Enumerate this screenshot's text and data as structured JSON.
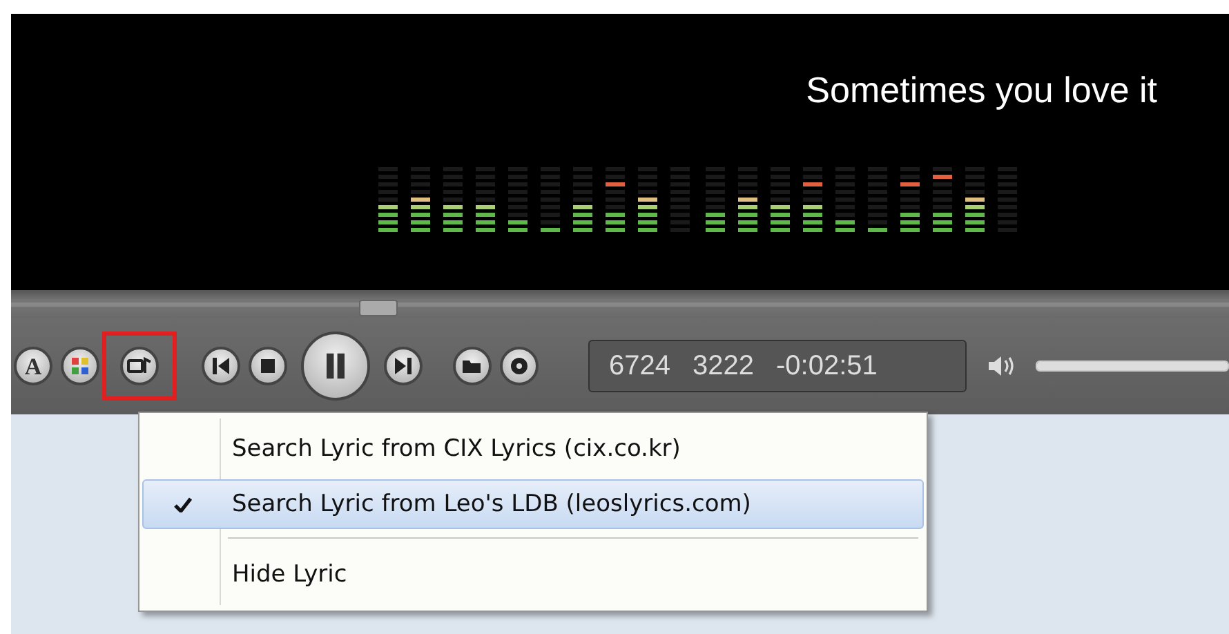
{
  "lyrics": {
    "line": "Sometimes you love it"
  },
  "toolbar": {
    "buttons": [
      {
        "kind": "font",
        "label": "A"
      },
      {
        "kind": "colors"
      },
      {
        "kind": "lyric",
        "highlighted": true
      },
      {
        "kind": "previous"
      },
      {
        "kind": "stop"
      },
      {
        "kind": "pause"
      },
      {
        "kind": "next"
      },
      {
        "kind": "open"
      },
      {
        "kind": "eject"
      }
    ],
    "display": [
      "6724",
      "3222",
      "-0:02:51"
    ],
    "volume": {
      "level": 1
    }
  },
  "menu": {
    "items": [
      {
        "kind": "item",
        "label": "Search Lyric from CIX Lyrics (cix.co.kr)",
        "checked": false,
        "selected": false
      },
      {
        "kind": "item",
        "label": "Search Lyric from Leo's LDB (leoslyrics.com)",
        "checked": true,
        "selected": true
      },
      {
        "kind": "separator"
      },
      {
        "kind": "item",
        "label": "Hide Lyric",
        "checked": false,
        "selected": false
      }
    ]
  }
}
